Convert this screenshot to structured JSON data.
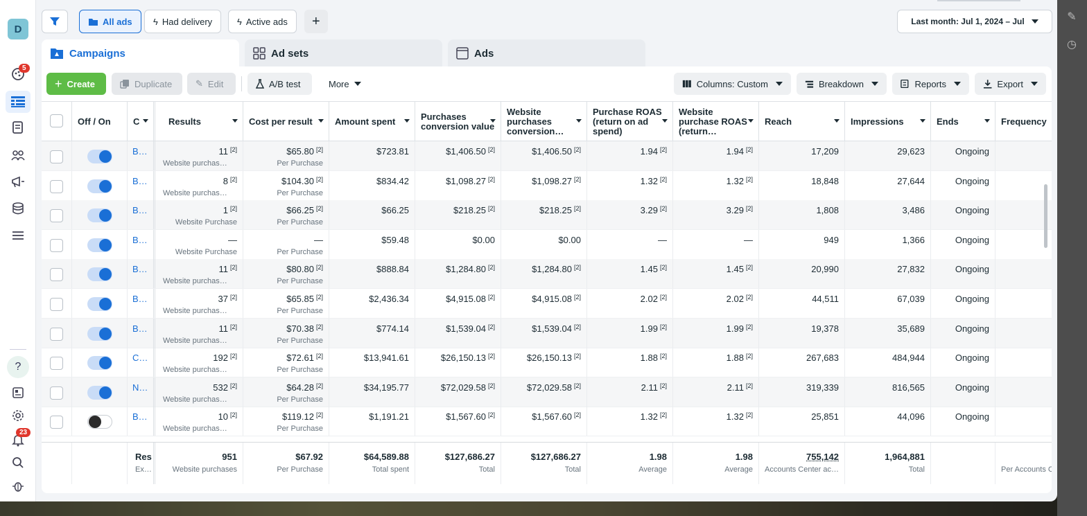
{
  "nav": {
    "avatar_letter": "D",
    "badge_notifications_top": "5",
    "badge_alerts": "23",
    "help_glyph": "?"
  },
  "topbar": {
    "filter_icon": "filter-icon",
    "views": [
      {
        "label": "All ads",
        "selected": true
      },
      {
        "label": "Had delivery",
        "selected": false
      },
      {
        "label": "Active ads",
        "selected": false
      }
    ],
    "add_view_label": "+",
    "date_range_label": "Last month: Jul 1, 2024 – Jul"
  },
  "tabs": [
    {
      "label": "Campaigns",
      "active": true
    },
    {
      "label": "Ad sets",
      "active": false
    },
    {
      "label": "Ads",
      "active": false
    }
  ],
  "toolbar": {
    "create_label": "Create",
    "duplicate_label": "Duplicate",
    "edit_label": "Edit",
    "ab_test_label": "A/B test",
    "more_label": "More",
    "columns_label": "Columns: Custom",
    "breakdown_label": "Breakdown",
    "reports_label": "Reports",
    "export_label": "Export"
  },
  "table": {
    "columns": {
      "offon": "Off / On",
      "name": "C",
      "results": "Results",
      "cpr": "Cost per result",
      "spent": "Amount spent",
      "pcv": "Purchases conversion value",
      "wpcv": "Website purchases conversion…",
      "proas": "Purchase ROAS (return on ad spend)",
      "wproas": "Website purchase ROAS (return…",
      "reach": "Reach",
      "impressions": "Impressions",
      "ends": "Ends",
      "frequency": "Frequency"
    },
    "footnote": "[2]",
    "rows": [
      {
        "on": true,
        "name": "B…",
        "results": "11",
        "results_sub": "Website purchas…",
        "cpr": "$65.80",
        "cpr_sub": "Per Purchase",
        "spent": "$723.81",
        "pcv": "$1,406.50",
        "wpcv": "$1,406.50",
        "proas": "1.94",
        "wproas": "1.94",
        "reach": "17,209",
        "impressions": "29,623",
        "ends": "Ongoing"
      },
      {
        "on": true,
        "name": "B…",
        "results": "8",
        "results_sub": "Website purchas…",
        "cpr": "$104.30",
        "cpr_sub": "Per Purchase",
        "spent": "$834.42",
        "pcv": "$1,098.27",
        "wpcv": "$1,098.27",
        "proas": "1.32",
        "wproas": "1.32",
        "reach": "18,848",
        "impressions": "27,644",
        "ends": "Ongoing"
      },
      {
        "on": true,
        "name": "B…",
        "results": "1",
        "results_sub": "Website Purchase",
        "cpr": "$66.25",
        "cpr_sub": "Per Purchase",
        "spent": "$66.25",
        "pcv": "$218.25",
        "wpcv": "$218.25",
        "proas": "3.29",
        "wproas": "3.29",
        "reach": "1,808",
        "impressions": "3,486",
        "ends": "Ongoing"
      },
      {
        "on": true,
        "name": "B…",
        "results": "—",
        "results_sub": "Website Purchase",
        "cpr": "—",
        "cpr_sub": "Per Purchase",
        "spent": "$59.48",
        "pcv": "$0.00",
        "wpcv": "$0.00",
        "proas": "—",
        "wproas": "—",
        "reach": "949",
        "impressions": "1,366",
        "ends": "Ongoing"
      },
      {
        "on": true,
        "name": "B…",
        "results": "11",
        "results_sub": "Website purchas…",
        "cpr": "$80.80",
        "cpr_sub": "Per Purchase",
        "spent": "$888.84",
        "pcv": "$1,284.80",
        "wpcv": "$1,284.80",
        "proas": "1.45",
        "wproas": "1.45",
        "reach": "20,990",
        "impressions": "27,832",
        "ends": "Ongoing"
      },
      {
        "on": true,
        "name": "B…",
        "results": "37",
        "results_sub": "Website purchas…",
        "cpr": "$65.85",
        "cpr_sub": "Per Purchase",
        "spent": "$2,436.34",
        "pcv": "$4,915.08",
        "wpcv": "$4,915.08",
        "proas": "2.02",
        "wproas": "2.02",
        "reach": "44,511",
        "impressions": "67,039",
        "ends": "Ongoing"
      },
      {
        "on": true,
        "name": "B…",
        "results": "11",
        "results_sub": "Website purchas…",
        "cpr": "$70.38",
        "cpr_sub": "Per Purchase",
        "spent": "$774.14",
        "pcv": "$1,539.04",
        "wpcv": "$1,539.04",
        "proas": "1.99",
        "wproas": "1.99",
        "reach": "19,378",
        "impressions": "35,689",
        "ends": "Ongoing"
      },
      {
        "on": true,
        "name": "C…",
        "results": "192",
        "results_sub": "Website purchas…",
        "cpr": "$72.61",
        "cpr_sub": "Per Purchase",
        "spent": "$13,941.61",
        "pcv": "$26,150.13",
        "wpcv": "$26,150.13",
        "proas": "1.88",
        "wproas": "1.88",
        "reach": "267,683",
        "impressions": "484,944",
        "ends": "Ongoing"
      },
      {
        "on": true,
        "name": "N…",
        "results": "532",
        "results_sub": "Website purchas…",
        "cpr": "$64.28",
        "cpr_sub": "Per Purchase",
        "spent": "$34,195.77",
        "pcv": "$72,029.58",
        "wpcv": "$72,029.58",
        "proas": "2.11",
        "wproas": "2.11",
        "reach": "319,339",
        "impressions": "816,565",
        "ends": "Ongoing"
      },
      {
        "on": false,
        "name": "B…",
        "results": "10",
        "results_sub": "Website purchas…",
        "cpr": "$119.12",
        "cpr_sub": "Per Purchase",
        "spent": "$1,191.21",
        "pcv": "$1,567.60",
        "wpcv": "$1,567.60",
        "proas": "1.32",
        "wproas": "1.32",
        "reach": "25,851",
        "impressions": "44,096",
        "ends": "Ongoing"
      }
    ],
    "totals": {
      "name": "Res",
      "name_sub": "Ex…",
      "results": "951",
      "results_sub": "Website purchases",
      "cpr": "$67.92",
      "cpr_sub": "Per Purchase",
      "spent": "$64,589.88",
      "spent_sub": "Total spent",
      "pcv": "$127,686.27",
      "pcv_sub": "Total",
      "wpcv": "$127,686.27",
      "wpcv_sub": "Total",
      "proas": "1.98",
      "proas_sub": "Average",
      "wproas": "1.98",
      "wproas_sub": "Average",
      "reach": "755,142",
      "reach_sub": "Accounts Center ac…",
      "impressions": "1,964,881",
      "impressions_sub": "Total",
      "frequency_sub": "Per Accounts C"
    }
  },
  "colors": {
    "accent": "#1a6fd6",
    "create_green": "#5ebc46",
    "badge_red": "#e0362c"
  }
}
